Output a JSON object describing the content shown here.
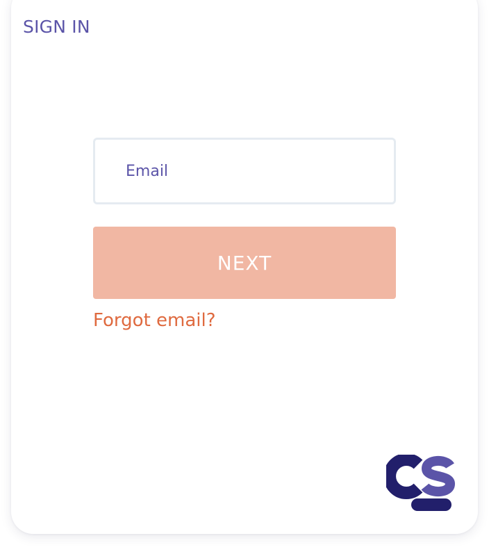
{
  "card": {
    "title": "SIGN IN"
  },
  "email": {
    "placeholder": "Email",
    "value": ""
  },
  "actions": {
    "next_label": "NEXT",
    "forgot_label": "Forgot email?"
  },
  "logo": {
    "icon": "cs-logo-icon",
    "text": "CS"
  },
  "colors": {
    "primary": "#5b54a8",
    "logo_dark": "#221f6b",
    "button_disabled": "#f1b7a3",
    "link": "#df6a3f",
    "input_border": "#e5ebf1"
  }
}
